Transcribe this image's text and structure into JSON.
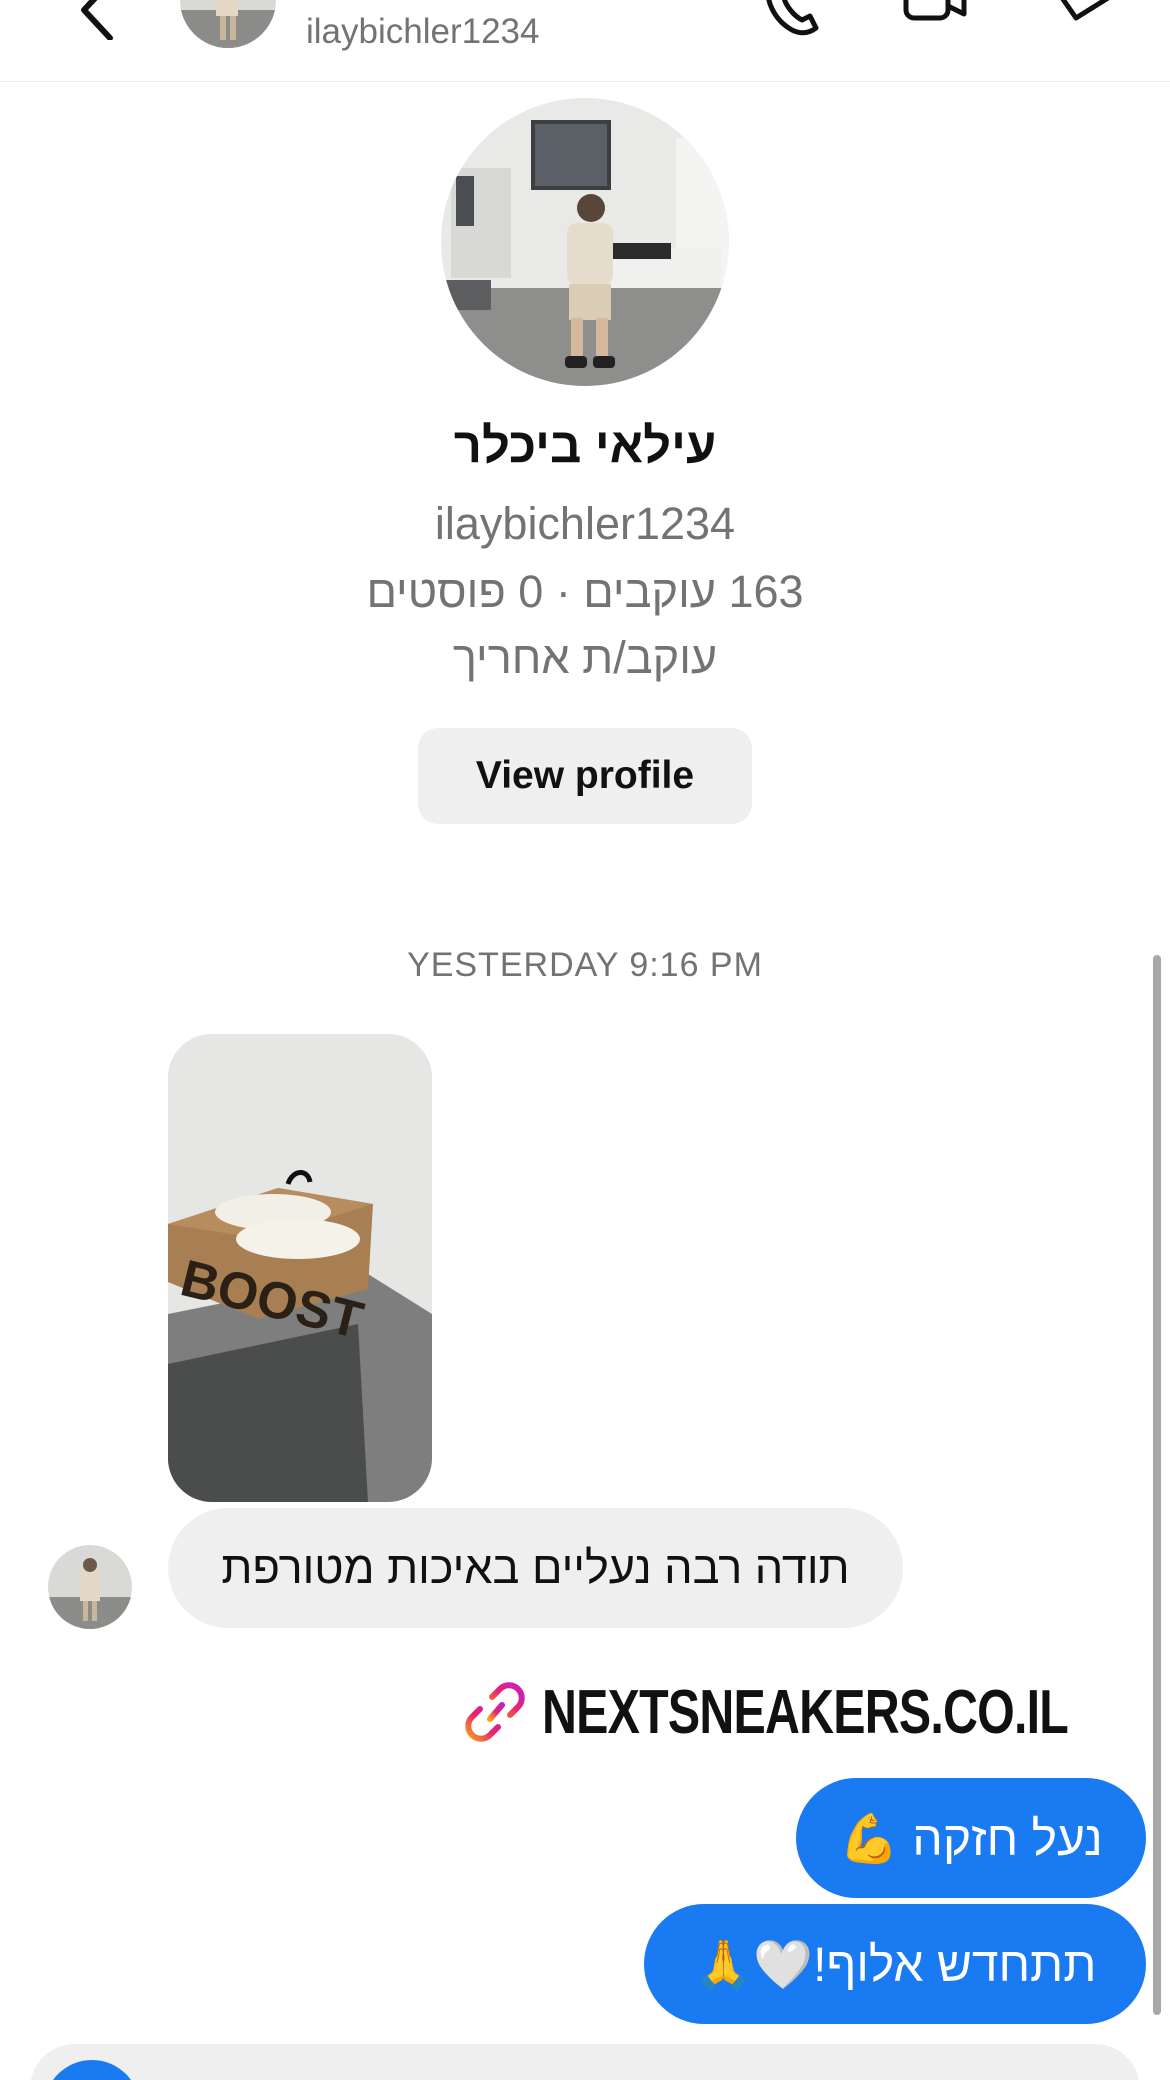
{
  "header": {
    "username": "ilaybichler1234",
    "back_icon": "chevron-left-icon",
    "call_icon": "phone-icon",
    "video_icon": "video-camera-icon",
    "tag_icon": "tag-icon"
  },
  "profile": {
    "display_name": "עילאי ביכלר",
    "username": "ilaybichler1234",
    "stats": "163 עוקבים · 0 פוסטים",
    "follow_status": "עוקב/ת אחריך",
    "view_profile_label": "View profile"
  },
  "conversation": {
    "timestamp": "YESTERDAY 9:16 PM",
    "incoming": [
      {
        "type": "photo",
        "caption": "BOOST"
      },
      {
        "type": "text",
        "text": "תודה רבה נעליים באיכות מטורפת"
      }
    ],
    "link_text": "NEXTSNEAKERS.CO.IL",
    "outgoing": [
      {
        "text": "נעל חזקה 💪"
      },
      {
        "text": "תתחדש אלוף!🤍🙏"
      }
    ]
  },
  "colors": {
    "accent": "#1a7af2",
    "bubble_gray": "#efefef",
    "secondary_text": "#737373"
  }
}
